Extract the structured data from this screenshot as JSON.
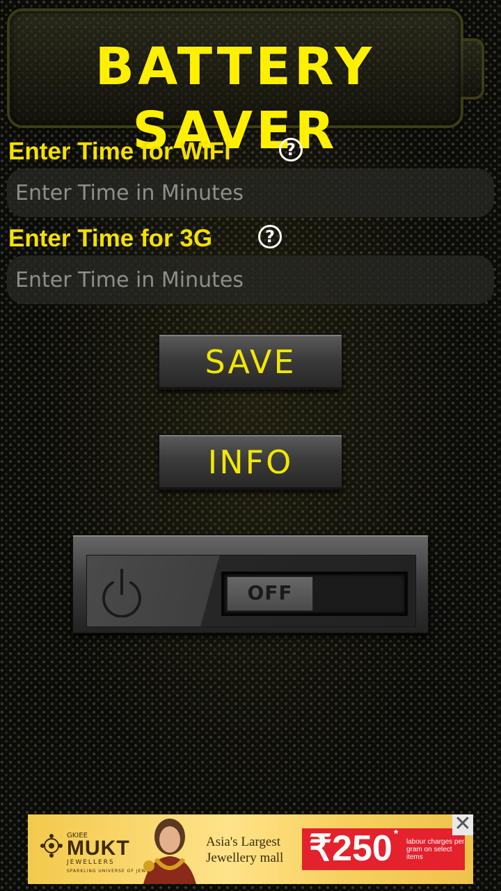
{
  "header": {
    "title": "BATTERY SAVER"
  },
  "wifi": {
    "label": "Enter Time for WiFi",
    "help_icon": "help-circle-icon",
    "input_value": "",
    "placeholder": "Enter Time in Minutes"
  },
  "mobile": {
    "label": "Enter Time for 3G",
    "help_icon": "help-circle-icon",
    "input_value": "",
    "placeholder": "Enter Time in Minutes"
  },
  "buttons": {
    "save_label": "SAVE",
    "info_label": "INFO"
  },
  "power_toggle": {
    "icon": "power-icon",
    "state_label": "OFF"
  },
  "help_glyph": "?",
  "ad": {
    "brand_small": "GKIEE",
    "brand": "MUKT",
    "brand_sub": "JEWELLERS",
    "tagline": "SPARKLING UNIVERSE OF JEWELS",
    "headline": "Asia's Largest Jewellery mall",
    "price": "₹250",
    "price_mark": "*",
    "fineprint": "labour charges per gram on select items",
    "close_glyph": "✕"
  },
  "colors": {
    "accent_yellow": "#ffef00",
    "background": "#0b0b08",
    "ad_red": "#e3222d"
  }
}
